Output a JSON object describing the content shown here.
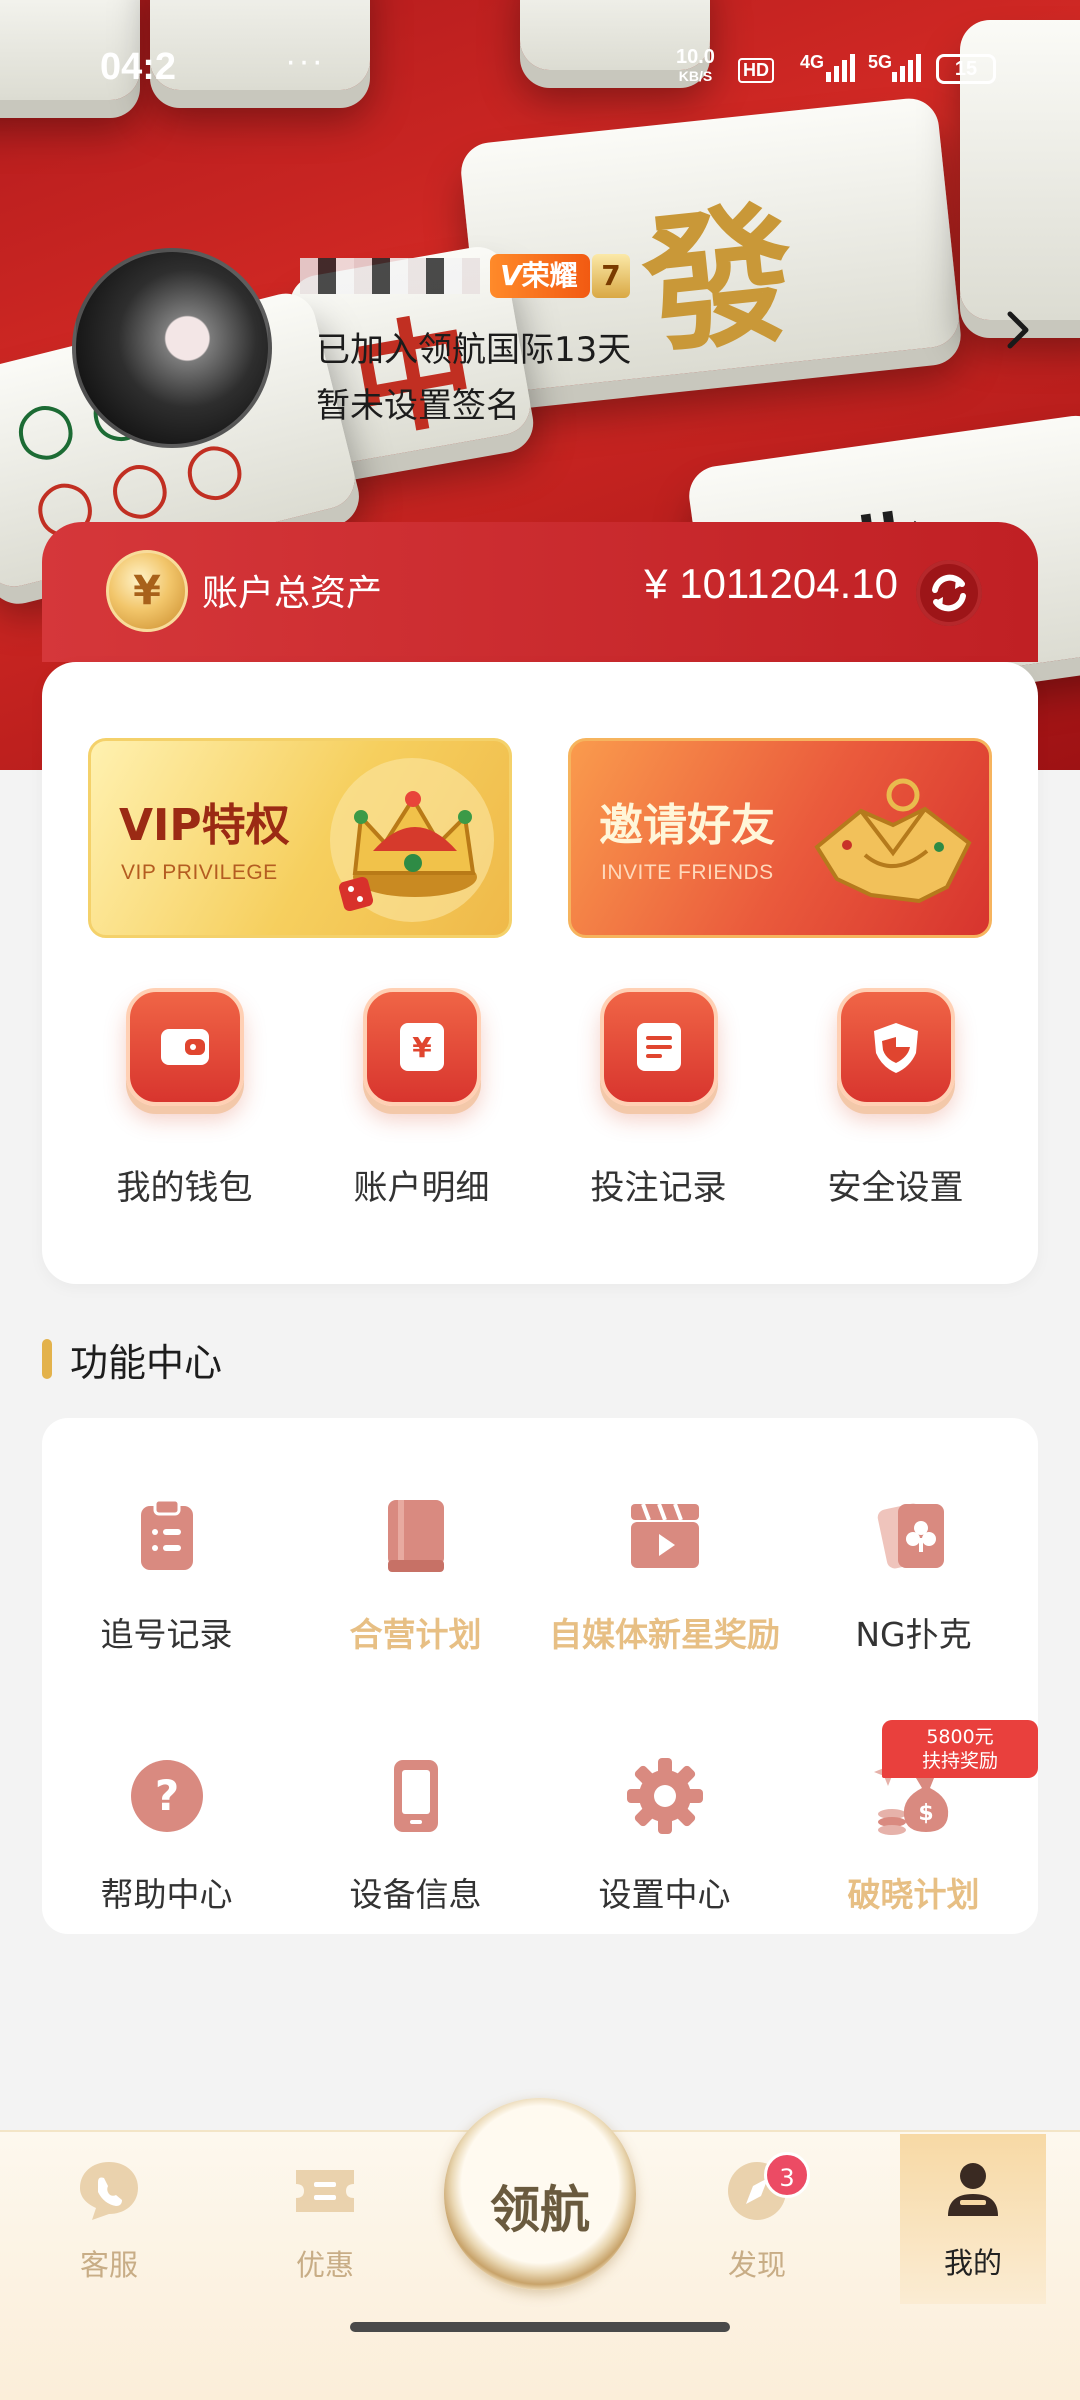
{
  "status_bar": {
    "time": "04:2",
    "network_speed": "10.0",
    "network_unit": "KB/S",
    "hd": "HD",
    "signal_1": "4G",
    "signal_2": "5G",
    "battery": "15"
  },
  "profile": {
    "vip_title": "荣耀",
    "vip_level": "7",
    "joined": "已加入领航国际13天",
    "signature": "暂未设置签名"
  },
  "assets": {
    "coin_symbol": "¥",
    "label": "账户总资产",
    "value": "¥ 1011204.10"
  },
  "promos": [
    {
      "title": "VIP特权",
      "subtitle": "VIP PRIVILEGE"
    },
    {
      "title": "邀请好友",
      "subtitle": "INVITE FRIENDS"
    }
  ],
  "quick_actions": [
    {
      "label": "我的钱包",
      "icon": "wallet-icon"
    },
    {
      "label": "账户明细",
      "icon": "yen-document-icon"
    },
    {
      "label": "投注记录",
      "icon": "record-icon"
    },
    {
      "label": "安全设置",
      "icon": "shield-icon"
    }
  ],
  "function_center": {
    "title": "功能中心",
    "items": [
      {
        "label": "追号记录",
        "icon": "clipboard-icon"
      },
      {
        "label": "合营计划",
        "icon": "book-icon"
      },
      {
        "label": "自媒体新星奖励",
        "icon": "video-clapper-icon"
      },
      {
        "label": "NG扑克",
        "icon": "poker-card-icon"
      },
      {
        "label": "帮助中心",
        "icon": "help-icon"
      },
      {
        "label": "设备信息",
        "icon": "phone-icon"
      },
      {
        "label": "设置中心",
        "icon": "gear-icon"
      },
      {
        "label": "破晓计划",
        "icon": "money-bag-icon"
      }
    ],
    "reward_tag": {
      "line1": "5800元",
      "line2": "扶持奖励"
    }
  },
  "tabbar": {
    "tabs": [
      {
        "label": "客服",
        "icon": "chat-icon"
      },
      {
        "label": "优惠",
        "icon": "ticket-icon"
      },
      {
        "label": "发现",
        "icon": "compass-icon",
        "badge": "3"
      },
      {
        "label": "我的",
        "icon": "user-icon",
        "active": true
      }
    ],
    "center_logo_text": "领航"
  },
  "colors": {
    "brand_red": "#c82227",
    "accent_gold": "#e3b24b",
    "icon_salmon": "#d98a80",
    "badge_pink": "#ec4b64"
  }
}
